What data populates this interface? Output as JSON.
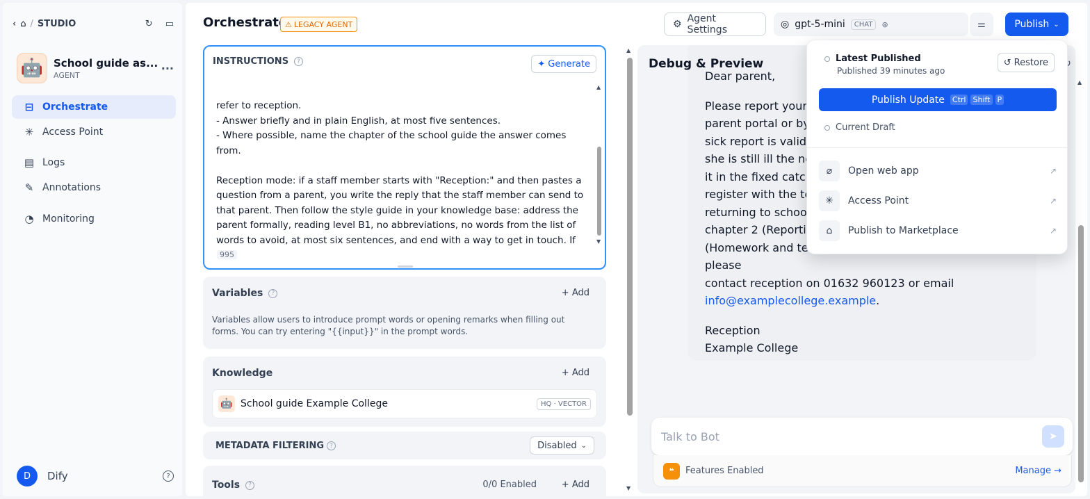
{
  "nav": {
    "studio": "STUDIO",
    "separator": "/"
  },
  "app": {
    "name": "School guide as...",
    "type": "AGENT",
    "more": "···"
  },
  "sidebar": {
    "items": [
      {
        "label": "Orchestrate",
        "icon": "⊟"
      },
      {
        "label": "Access Point",
        "icon": "✳"
      },
      {
        "label": "Logs",
        "icon": "▤"
      },
      {
        "label": "Annotations",
        "icon": "✎"
      },
      {
        "label": "Monitoring",
        "icon": "◔"
      }
    ]
  },
  "user": {
    "initial": "D",
    "name": "Dify",
    "help": "?"
  },
  "header": {
    "title": "Orchestrate",
    "legacy_badge": "LEGACY AGENT",
    "agent_settings": "Agent Settings",
    "model": "gpt-5-mini",
    "model_mode": "CHAT",
    "publish": "Publish"
  },
  "instructions": {
    "title": "INSTRUCTIONS",
    "generate": "Generate",
    "text": "refer to reception.\n- Answer briefly and in plain English, at most five sentences.\n- Where possible, name the chapter of the school guide the answer comes from.\n\nReception mode: if a staff member starts with \"Reception:\" and then pastes a question from a parent, you write the reply that the staff member can send to that parent. Then follow the style guide in your knowledge base: address the parent formally, reading level B1, no abbreviations, no words from the list of words to avoid, at most six sentences, and end with a way to get in touch. If you do not know the answer from the school guide, write a short message saying you will check and put [FILL IN] where the staff member must add the real answer.",
    "count": "995"
  },
  "variables": {
    "title": "Variables",
    "add": "+ Add",
    "desc": "Variables allow users to introduce prompt words or opening remarks when filling out forms. You can try entering \"{{input}}\" in the prompt words."
  },
  "knowledge": {
    "title": "Knowledge",
    "add": "+ Add",
    "item": "School guide Example College",
    "badge": "HQ · VECTOR"
  },
  "metadata": {
    "title": "METADATA FILTERING",
    "value": "Disabled"
  },
  "tools": {
    "title": "Tools",
    "enabled": "0/0 Enabled",
    "add": "+ Add"
  },
  "debug": {
    "title": "Debug & Preview",
    "greeting": "Dear parent,",
    "body_lines": [
      "Please report your c",
      "parent portal or by",
      "sick report is valid f",
      "she is still ill the nex",
      "it in the fixed catch-",
      "register with the tea",
      "returning to school.",
      "chapter 2 (Reportin",
      "(Homework and tests). If you need further help, please",
      "contact reception on 01632 960123 or email"
    ],
    "email": "info@examplecollege.example",
    "signoff": "Reception",
    "signoff2": "Example College",
    "input_placeholder": "Talk to Bot",
    "features": "Features Enabled",
    "manage": "Manage →"
  },
  "dropdown": {
    "latest": "Latest Published",
    "published_ago": "Published 39 minutes ago",
    "restore": "Restore",
    "publish_update": "Publish Update",
    "keys": [
      "Ctrl",
      "Shift",
      "P"
    ],
    "current_draft": "Current Draft",
    "items": [
      {
        "label": "Open web app",
        "icon": "⌀"
      },
      {
        "label": "Access Point",
        "icon": "✳"
      },
      {
        "label": "Publish to Marketplace",
        "icon": "⌂"
      }
    ]
  },
  "colors": {
    "accent": "#155aef",
    "warning": "#dc6803",
    "active_bg": "#e6ecfb"
  }
}
